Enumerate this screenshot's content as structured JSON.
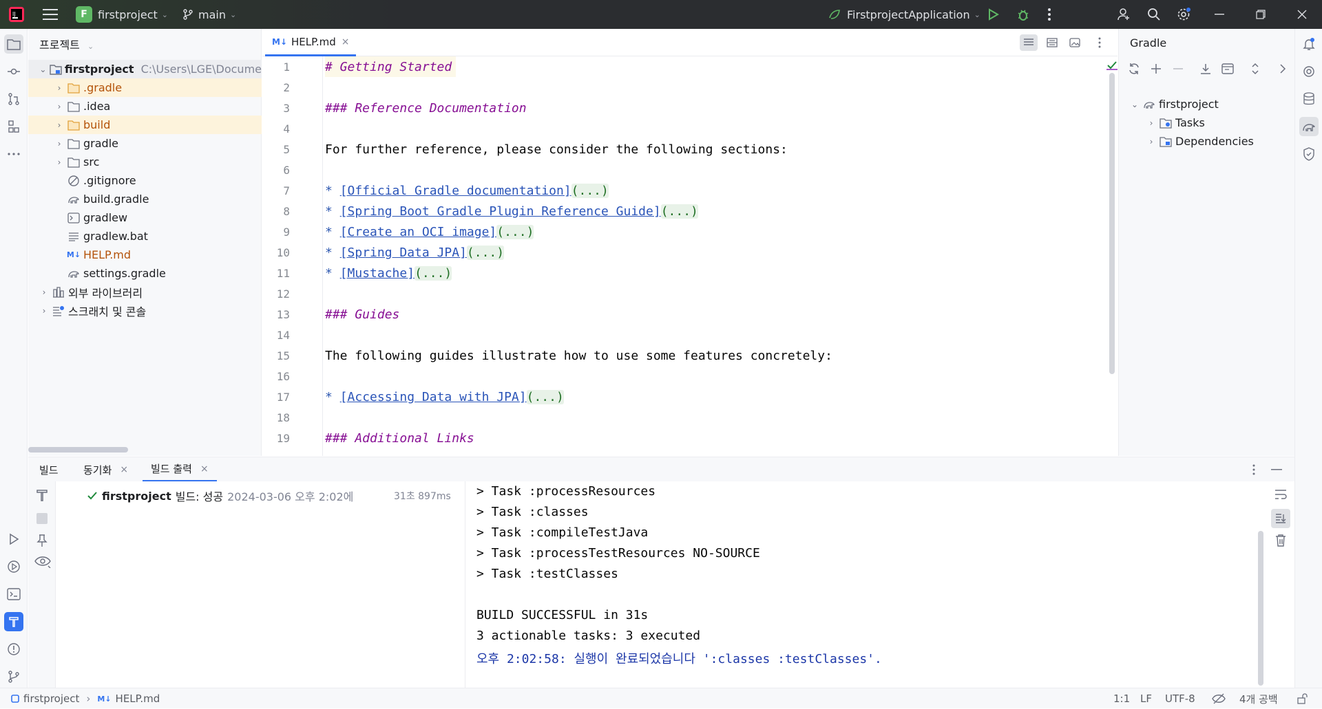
{
  "titlebar": {
    "project_initial": "F",
    "project_name": "firstproject",
    "branch": "main",
    "run_config": "FirstprojectApplication"
  },
  "project_panel": {
    "title": "프로젝트",
    "root": {
      "name": "firstproject",
      "path": "C:\\Users\\LGE\\Docume"
    },
    "items": [
      {
        "label": ".gradle"
      },
      {
        "label": ".idea"
      },
      {
        "label": "build"
      },
      {
        "label": "gradle"
      },
      {
        "label": "src"
      },
      {
        "label": ".gitignore"
      },
      {
        "label": "build.gradle"
      },
      {
        "label": "gradlew"
      },
      {
        "label": "gradlew.bat"
      },
      {
        "label": "HELP.md"
      },
      {
        "label": "settings.gradle"
      },
      {
        "label": "외부 라이브러리"
      },
      {
        "label": "스크래치 및 콘솔"
      }
    ]
  },
  "editor": {
    "tab_prefix": "M↓",
    "tab_label": "HELP.md",
    "fold": "(...)",
    "bullet": "*",
    "lines": {
      "l1": "# Getting Started",
      "l3": "### Reference Documentation",
      "l5": "For further reference, please consider the following sections:",
      "l7": "[Official Gradle documentation]",
      "l8": "[Spring Boot Gradle Plugin Reference Guide]",
      "l9": "[Create an OCI image]",
      "l10": "[Spring Data JPA]",
      "l11": "[Mustache]",
      "l13": "### Guides",
      "l15": "The following guides illustrate how to use some features concretely:",
      "l17": "[Accessing Data with JPA]",
      "l19": "### Additional Links"
    },
    "line_numbers": [
      "1",
      "2",
      "3",
      "4",
      "5",
      "6",
      "7",
      "8",
      "9",
      "10",
      "11",
      "12",
      "13",
      "14",
      "15",
      "16",
      "17",
      "18",
      "19"
    ]
  },
  "gradle_panel": {
    "title": "Gradle",
    "root": "firstproject",
    "children": [
      "Tasks",
      "Dependencies"
    ]
  },
  "bottom": {
    "tabs": [
      "빌드",
      "동기화",
      "빌드 출력"
    ],
    "build_entry": {
      "name": "firstproject",
      "status": "빌드: 성공",
      "when": "2024-03-06 오후 2:02에",
      "duration": "31초 897ms"
    },
    "console": [
      "> Task :processResources",
      "> Task :classes",
      "> Task :compileTestJava",
      "> Task :processTestResources NO-SOURCE",
      "> Task :testClasses",
      "",
      "BUILD SUCCESSFUL in 31s",
      "3 actionable tasks: 3 executed",
      "오후 2:02:58: 실행이 완료되었습니다 ':classes :testClasses'."
    ]
  },
  "statusbar": {
    "crumb_project": "firstproject",
    "crumb_file_prefix": "M↓",
    "crumb_file": "HELP.md",
    "position": "1:1",
    "line_sep": "LF",
    "encoding": "UTF-8",
    "indent": "4개 공백"
  },
  "colors": {
    "accent": "#3574f0",
    "success": "#208a3c",
    "selection": "#fdf3dc"
  }
}
